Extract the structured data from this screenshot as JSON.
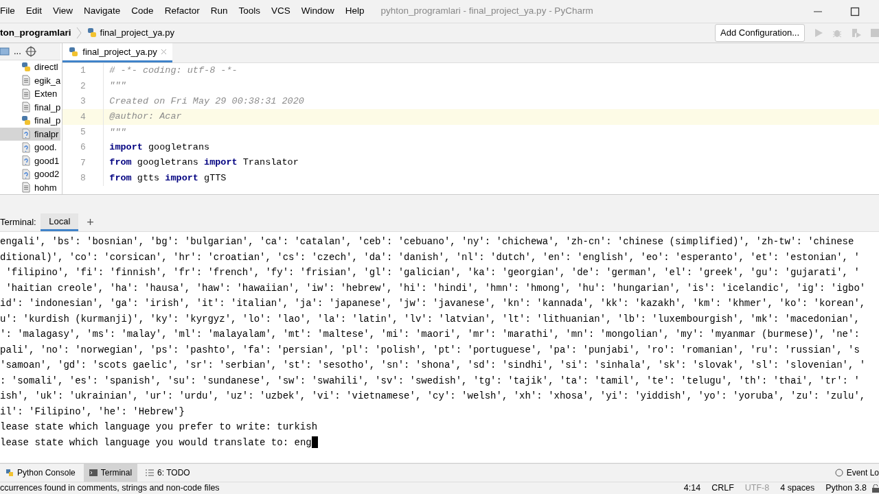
{
  "window": {
    "title": "pyhton_programlari - final_project_ya.py - PyCharm"
  },
  "menu": [
    "File",
    "Edit",
    "View",
    "Navigate",
    "Code",
    "Refactor",
    "Run",
    "Tools",
    "VCS",
    "Window",
    "Help"
  ],
  "breadcrumb": {
    "project": "ton_programlari",
    "file": "final_project_ya.py"
  },
  "toolbar": {
    "config_button": "Add Configuration..."
  },
  "project_panel": {
    "toolbar_label": "...",
    "items": [
      {
        "label": "directl",
        "kind": "python"
      },
      {
        "label": "egik_a",
        "kind": "text"
      },
      {
        "label": "Exten",
        "kind": "text"
      },
      {
        "label": "final_p",
        "kind": "text"
      },
      {
        "label": "final_p",
        "kind": "python"
      },
      {
        "label": "finalpr",
        "kind": "unknown",
        "selected": true
      },
      {
        "label": "good.",
        "kind": "unknown",
        "selected": false
      },
      {
        "label": "good1",
        "kind": "unknown",
        "selected": false
      },
      {
        "label": "good2",
        "kind": "unknown",
        "selected": false
      },
      {
        "label": "hohm",
        "kind": "text",
        "selected": false
      }
    ]
  },
  "editor": {
    "tabs": [
      {
        "label": "final_project_ya.py",
        "selected": true
      }
    ],
    "lines": [
      {
        "number": "1",
        "current": false,
        "segments": [
          {
            "kind": "comment",
            "text": "# -*- coding: utf-8 -*-"
          }
        ]
      },
      {
        "number": "2",
        "current": false,
        "segments": [
          {
            "kind": "comment",
            "text": "\"\"\""
          }
        ]
      },
      {
        "number": "3",
        "current": false,
        "segments": [
          {
            "kind": "comment",
            "text": "Created on Fri May 29 00:38:31 2020"
          }
        ]
      },
      {
        "number": "4",
        "current": true,
        "segments": [
          {
            "kind": "comment",
            "text": "@author: Acar"
          }
        ]
      },
      {
        "number": "5",
        "current": false,
        "segments": [
          {
            "kind": "comment",
            "text": "\"\"\""
          }
        ]
      },
      {
        "number": "6",
        "current": false,
        "segments": [
          {
            "kind": "keyword",
            "text": "import"
          },
          {
            "kind": "plain",
            "text": " googletrans"
          }
        ]
      },
      {
        "number": "7",
        "current": false,
        "segments": [
          {
            "kind": "keyword",
            "text": "from"
          },
          {
            "kind": "plain",
            "text": " googletrans "
          },
          {
            "kind": "keyword",
            "text": "import"
          },
          {
            "kind": "plain",
            "text": " Translator"
          }
        ]
      },
      {
        "number": "8",
        "current": false,
        "segments": [
          {
            "kind": "keyword",
            "text": "from"
          },
          {
            "kind": "plain",
            "text": " gtts "
          },
          {
            "kind": "keyword",
            "text": "import"
          },
          {
            "kind": "plain",
            "text": " gTTS"
          }
        ]
      }
    ]
  },
  "terminal": {
    "label": "Terminal:",
    "tabs": [
      {
        "label": "Local",
        "selected": true
      }
    ],
    "add": "+",
    "lines": [
      "engali', 'bs': 'bosnian', 'bg': 'bulgarian', 'ca': 'catalan', 'ceb': 'cebuano', 'ny': 'chichewa', 'zh-cn': 'chinese (simplified)', 'zh-tw': 'chinese",
      "ditional)', 'co': 'corsican', 'hr': 'croatian', 'cs': 'czech', 'da': 'danish', 'nl': 'dutch', 'en': 'english', 'eo': 'esperanto', 'et': 'estonian', '",
      " 'filipino', 'fi': 'finnish', 'fr': 'french', 'fy': 'frisian', 'gl': 'galician', 'ka': 'georgian', 'de': 'german', 'el': 'greek', 'gu': 'gujarati', '",
      " 'haitian creole', 'ha': 'hausa', 'haw': 'hawaiian', 'iw': 'hebrew', 'hi': 'hindi', 'hmn': 'hmong', 'hu': 'hungarian', 'is': 'icelandic', 'ig': 'igbo'",
      "id': 'indonesian', 'ga': 'irish', 'it': 'italian', 'ja': 'japanese', 'jw': 'javanese', 'kn': 'kannada', 'kk': 'kazakh', 'km': 'khmer', 'ko': 'korean',",
      "u': 'kurdish (kurmanji)', 'ky': 'kyrgyz', 'lo': 'lao', 'la': 'latin', 'lv': 'latvian', 'lt': 'lithuanian', 'lb': 'luxembourgish', 'mk': 'macedonian',",
      "': 'malagasy', 'ms': 'malay', 'ml': 'malayalam', 'mt': 'maltese', 'mi': 'maori', 'mr': 'marathi', 'mn': 'mongolian', 'my': 'myanmar (burmese)', 'ne':",
      "pali', 'no': 'norwegian', 'ps': 'pashto', 'fa': 'persian', 'pl': 'polish', 'pt': 'portuguese', 'pa': 'punjabi', 'ro': 'romanian', 'ru': 'russian', 's",
      "'samoan', 'gd': 'scots gaelic', 'sr': 'serbian', 'st': 'sesotho', 'sn': 'shona', 'sd': 'sindhi', 'si': 'sinhala', 'sk': 'slovak', 'sl': 'slovenian', '",
      ": 'somali', 'es': 'spanish', 'su': 'sundanese', 'sw': 'swahili', 'sv': 'swedish', 'tg': 'tajik', 'ta': 'tamil', 'te': 'telugu', 'th': 'thai', 'tr': '",
      "ish', 'uk': 'ukrainian', 'ur': 'urdu', 'uz': 'uzbek', 'vi': 'vietnamese', 'cy': 'welsh', 'xh': 'xhosa', 'yi': 'yiddish', 'yo': 'yoruba', 'zu': 'zulu',",
      "il': 'Filipino', 'he': 'Hebrew'}",
      "lease state which language you prefer to write: turkish"
    ],
    "input": {
      "prompt": "lease state which language you would translate to: ",
      "value": "eng"
    }
  },
  "tool_windows": [
    {
      "label": "Python Console",
      "kind": "console",
      "selected": false
    },
    {
      "label": "Terminal",
      "kind": "terminal",
      "selected": true
    },
    {
      "label": "6: TODO",
      "kind": "todo",
      "selected": false
    }
  ],
  "event_log": "Event Lo",
  "status_bar": {
    "message": "ccurrences found in comments, strings and non-code files",
    "items": [
      {
        "text": "4:14",
        "muted": false
      },
      {
        "text": "CRLF",
        "muted": false
      },
      {
        "text": "UTF-8",
        "muted": true
      },
      {
        "text": "4 spaces",
        "muted": false
      },
      {
        "text": "Python 3.8",
        "muted": false
      }
    ]
  }
}
